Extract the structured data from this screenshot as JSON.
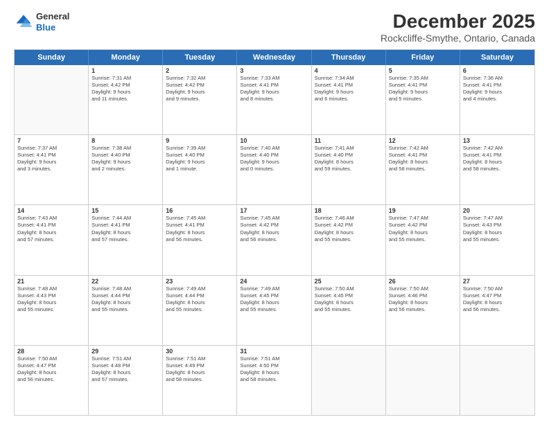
{
  "header": {
    "logo_line1": "General",
    "logo_line2": "Blue",
    "title": "December 2025",
    "subtitle": "Rockcliffe-Smythe, Ontario, Canada"
  },
  "days_of_week": [
    "Sunday",
    "Monday",
    "Tuesday",
    "Wednesday",
    "Thursday",
    "Friday",
    "Saturday"
  ],
  "weeks": [
    [
      {
        "day": "",
        "lines": []
      },
      {
        "day": "1",
        "lines": [
          "Sunrise: 7:31 AM",
          "Sunset: 4:42 PM",
          "Daylight: 9 hours",
          "and 11 minutes."
        ]
      },
      {
        "day": "2",
        "lines": [
          "Sunrise: 7:32 AM",
          "Sunset: 4:42 PM",
          "Daylight: 9 hours",
          "and 9 minutes."
        ]
      },
      {
        "day": "3",
        "lines": [
          "Sunrise: 7:33 AM",
          "Sunset: 4:41 PM",
          "Daylight: 9 hours",
          "and 8 minutes."
        ]
      },
      {
        "day": "4",
        "lines": [
          "Sunrise: 7:34 AM",
          "Sunset: 4:41 PM",
          "Daylight: 9 hours",
          "and 6 minutes."
        ]
      },
      {
        "day": "5",
        "lines": [
          "Sunrise: 7:35 AM",
          "Sunset: 4:41 PM",
          "Daylight: 9 hours",
          "and 5 minutes."
        ]
      },
      {
        "day": "6",
        "lines": [
          "Sunrise: 7:36 AM",
          "Sunset: 4:41 PM",
          "Daylight: 9 hours",
          "and 4 minutes."
        ]
      }
    ],
    [
      {
        "day": "7",
        "lines": [
          "Sunrise: 7:37 AM",
          "Sunset: 4:41 PM",
          "Daylight: 9 hours",
          "and 3 minutes."
        ]
      },
      {
        "day": "8",
        "lines": [
          "Sunrise: 7:38 AM",
          "Sunset: 4:40 PM",
          "Daylight: 9 hours",
          "and 2 minutes."
        ]
      },
      {
        "day": "9",
        "lines": [
          "Sunrise: 7:39 AM",
          "Sunset: 4:40 PM",
          "Daylight: 9 hours",
          "and 1 minute."
        ]
      },
      {
        "day": "10",
        "lines": [
          "Sunrise: 7:40 AM",
          "Sunset: 4:40 PM",
          "Daylight: 9 hours",
          "and 0 minutes."
        ]
      },
      {
        "day": "11",
        "lines": [
          "Sunrise: 7:41 AM",
          "Sunset: 4:40 PM",
          "Daylight: 8 hours",
          "and 59 minutes."
        ]
      },
      {
        "day": "12",
        "lines": [
          "Sunrise: 7:42 AM",
          "Sunset: 4:41 PM",
          "Daylight: 8 hours",
          "and 58 minutes."
        ]
      },
      {
        "day": "13",
        "lines": [
          "Sunrise: 7:42 AM",
          "Sunset: 4:41 PM",
          "Daylight: 8 hours",
          "and 58 minutes."
        ]
      }
    ],
    [
      {
        "day": "14",
        "lines": [
          "Sunrise: 7:43 AM",
          "Sunset: 4:41 PM",
          "Daylight: 8 hours",
          "and 57 minutes."
        ]
      },
      {
        "day": "15",
        "lines": [
          "Sunrise: 7:44 AM",
          "Sunset: 4:41 PM",
          "Daylight: 8 hours",
          "and 57 minutes."
        ]
      },
      {
        "day": "16",
        "lines": [
          "Sunrise: 7:45 AM",
          "Sunset: 4:41 PM",
          "Daylight: 8 hours",
          "and 56 minutes."
        ]
      },
      {
        "day": "17",
        "lines": [
          "Sunrise: 7:45 AM",
          "Sunset: 4:42 PM",
          "Daylight: 8 hours",
          "and 56 minutes."
        ]
      },
      {
        "day": "18",
        "lines": [
          "Sunrise: 7:46 AM",
          "Sunset: 4:42 PM",
          "Daylight: 8 hours",
          "and 55 minutes."
        ]
      },
      {
        "day": "19",
        "lines": [
          "Sunrise: 7:47 AM",
          "Sunset: 4:42 PM",
          "Daylight: 8 hours",
          "and 55 minutes."
        ]
      },
      {
        "day": "20",
        "lines": [
          "Sunrise: 7:47 AM",
          "Sunset: 4:43 PM",
          "Daylight: 8 hours",
          "and 55 minutes."
        ]
      }
    ],
    [
      {
        "day": "21",
        "lines": [
          "Sunrise: 7:48 AM",
          "Sunset: 4:43 PM",
          "Daylight: 8 hours",
          "and 55 minutes."
        ]
      },
      {
        "day": "22",
        "lines": [
          "Sunrise: 7:48 AM",
          "Sunset: 4:44 PM",
          "Daylight: 8 hours",
          "and 55 minutes."
        ]
      },
      {
        "day": "23",
        "lines": [
          "Sunrise: 7:49 AM",
          "Sunset: 4:44 PM",
          "Daylight: 8 hours",
          "and 55 minutes."
        ]
      },
      {
        "day": "24",
        "lines": [
          "Sunrise: 7:49 AM",
          "Sunset: 4:45 PM",
          "Daylight: 8 hours",
          "and 55 minutes."
        ]
      },
      {
        "day": "25",
        "lines": [
          "Sunrise: 7:50 AM",
          "Sunset: 4:45 PM",
          "Daylight: 8 hours",
          "and 55 minutes."
        ]
      },
      {
        "day": "26",
        "lines": [
          "Sunrise: 7:50 AM",
          "Sunset: 4:46 PM",
          "Daylight: 8 hours",
          "and 56 minutes."
        ]
      },
      {
        "day": "27",
        "lines": [
          "Sunrise: 7:50 AM",
          "Sunset: 4:47 PM",
          "Daylight: 8 hours",
          "and 56 minutes."
        ]
      }
    ],
    [
      {
        "day": "28",
        "lines": [
          "Sunrise: 7:50 AM",
          "Sunset: 4:47 PM",
          "Daylight: 8 hours",
          "and 56 minutes."
        ]
      },
      {
        "day": "29",
        "lines": [
          "Sunrise: 7:51 AM",
          "Sunset: 4:48 PM",
          "Daylight: 8 hours",
          "and 57 minutes."
        ]
      },
      {
        "day": "30",
        "lines": [
          "Sunrise: 7:51 AM",
          "Sunset: 4:49 PM",
          "Daylight: 8 hours",
          "and 58 minutes."
        ]
      },
      {
        "day": "31",
        "lines": [
          "Sunrise: 7:51 AM",
          "Sunset: 4:50 PM",
          "Daylight: 8 hours",
          "and 58 minutes."
        ]
      },
      {
        "day": "",
        "lines": []
      },
      {
        "day": "",
        "lines": []
      },
      {
        "day": "",
        "lines": []
      }
    ]
  ]
}
